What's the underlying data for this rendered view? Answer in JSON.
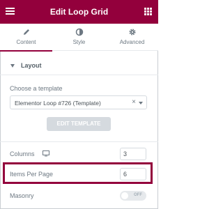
{
  "header": {
    "title": "Edit Loop Grid",
    "menu_icon": "hamburger-menu-icon",
    "grid_icon": "apps-grid-icon"
  },
  "tabs": [
    {
      "label": "Content",
      "icon": "pencil-icon",
      "active": true
    },
    {
      "label": "Style",
      "icon": "contrast-icon",
      "active": false
    },
    {
      "label": "Advanced",
      "icon": "gear-icon",
      "active": false
    }
  ],
  "section": {
    "title": "Layout"
  },
  "template": {
    "label": "Choose a template",
    "value": "Elementor Loop #726 (Template)",
    "clear": "×",
    "button": "EDIT TEMPLATE"
  },
  "columns": {
    "label": "Columns",
    "value": "3",
    "device_icon": "desktop-icon"
  },
  "items_per_page": {
    "label": "Items Per Page",
    "value": "6"
  },
  "masonry": {
    "label": "Masonry",
    "toggle_text": "OFF"
  },
  "colors": {
    "brand": "#93003c",
    "text": "#6d7882",
    "border": "#d5dadf"
  }
}
